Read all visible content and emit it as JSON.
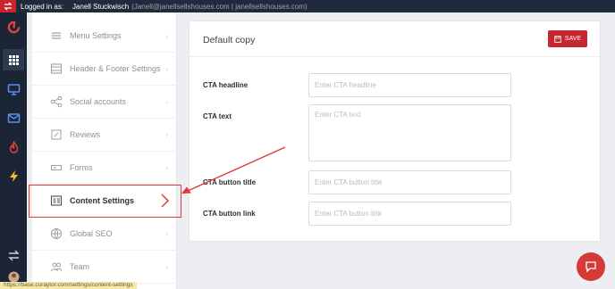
{
  "topbar": {
    "logged_in_label": "Logged in as:",
    "user_name": "Janell Stuckwisch",
    "user_meta": "(Janell@janellsellshouses.com | janellsellshouses.com)"
  },
  "rail": {
    "icons": [
      "switch-account-icon",
      "curator-logo-icon",
      "apps-grid-icon",
      "monitor-icon",
      "mail-icon",
      "fire-icon",
      "bolt-icon",
      "swap-icon",
      "avatar"
    ]
  },
  "sidebar": {
    "items": [
      {
        "label": "Menu Settings",
        "icon": "menu-icon"
      },
      {
        "label": "Header & Footer Settings",
        "icon": "layout-icon"
      },
      {
        "label": "Social accounts",
        "icon": "share-icon"
      },
      {
        "label": "Reviews",
        "icon": "edit-icon"
      },
      {
        "label": "Forms",
        "icon": "form-icon"
      },
      {
        "label": "Content Settings",
        "icon": "content-icon",
        "active": true
      },
      {
        "label": "Global SEO",
        "icon": "globe-icon"
      },
      {
        "label": "Team",
        "icon": "team-icon"
      }
    ]
  },
  "card": {
    "title": "Default copy",
    "save_label": "SAVE",
    "fields": [
      {
        "label": "CTA headline",
        "placeholder": "Enter CTA headline",
        "value": ""
      },
      {
        "label": "CTA text",
        "placeholder": "Enter CTA text",
        "value": ""
      },
      {
        "label": "CTA button title",
        "placeholder": "Enter CTA button title",
        "value": ""
      },
      {
        "label": "CTA button link",
        "placeholder": "Enter CTA button link",
        "value": ""
      }
    ]
  },
  "status_url": "https://base.curaytor.com/settings/content-settings",
  "colors": {
    "brand_red": "#c8262e",
    "rail_bg": "#1b2535",
    "annotation_red": "#e03a3a"
  }
}
